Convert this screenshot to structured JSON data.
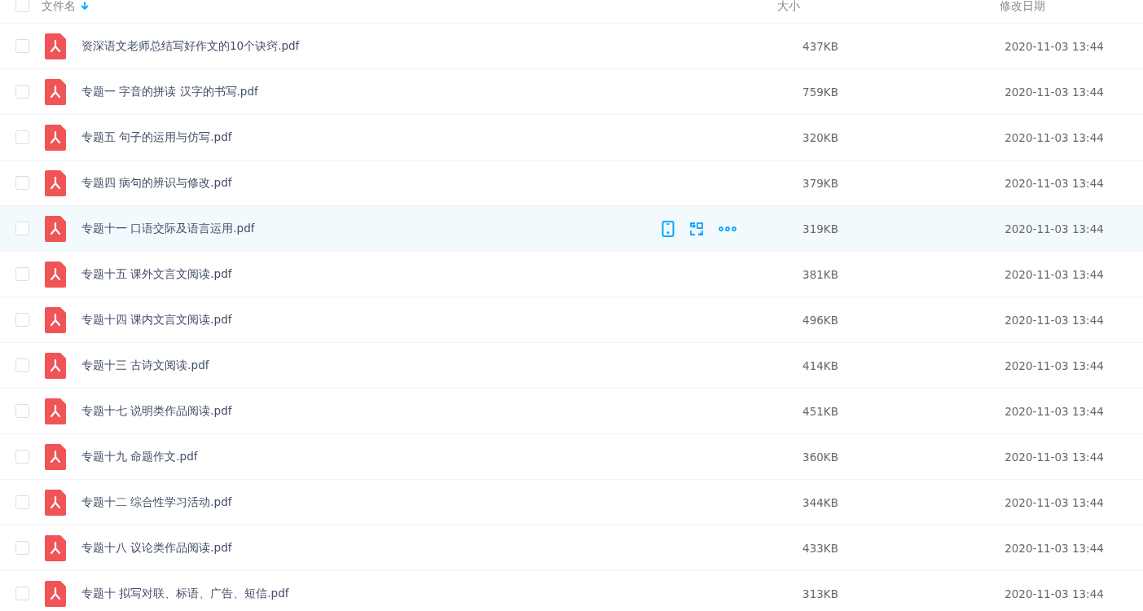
{
  "header": {
    "checked": false,
    "columns": [
      "文件名",
      "大小",
      "修改日期"
    ]
  },
  "rows": [
    {
      "name": "资深语文老师总结写好作文的10个诀窍.pdf",
      "size": "437KB",
      "date": "2020-11-03 13:44",
      "checked": false,
      "hovered": false
    },
    {
      "name": "专题一 字音的拼读 汉字的书写.pdf",
      "size": "759KB",
      "date": "2020-11-03 13:44",
      "checked": false,
      "hovered": false
    },
    {
      "name": "专题五 句子的运用与仿写.pdf",
      "size": "320KB",
      "date": "2020-11-03 13:44",
      "checked": false,
      "hovered": false
    },
    {
      "name": "专题四 病句的辨识与修改.pdf",
      "size": "379KB",
      "date": "2020-11-03 13:44",
      "checked": false,
      "hovered": false
    },
    {
      "name": "专题十一 口语交际及语言运用.pdf",
      "size": "319KB",
      "date": "2020-11-03 13:44",
      "checked": false,
      "hovered": true
    },
    {
      "name": "专题十五 课外文言文阅读.pdf",
      "size": "381KB",
      "date": "2020-11-03 13:44",
      "checked": false,
      "hovered": false
    },
    {
      "name": "专题十四 课内文言文阅读.pdf",
      "size": "496KB",
      "date": "2020-11-03 13:44",
      "checked": false,
      "hovered": false
    },
    {
      "name": "专题十三 古诗文阅读.pdf",
      "size": "414KB",
      "date": "2020-11-03 13:44",
      "checked": false,
      "hovered": false
    },
    {
      "name": "专题十七 说明类作品阅读.pdf",
      "size": "451KB",
      "date": "2020-11-03 13:44",
      "checked": false,
      "hovered": false
    },
    {
      "name": "专题十九 命题作文.pdf",
      "size": "360KB",
      "date": "2020-11-03 13:44",
      "checked": false,
      "hovered": false
    },
    {
      "name": "专题十二 综合性学习活动.pdf",
      "size": "344KB",
      "date": "2020-11-03 13:44",
      "checked": false,
      "hovered": false
    },
    {
      "name": "专题十八 议论类作品阅读.pdf",
      "size": "433KB",
      "date": "2020-11-03 13:44",
      "checked": false,
      "hovered": false
    },
    {
      "name": "专题十 拟写对联、标语、广告、短信.pdf",
      "size": "313KB",
      "date": "2020-11-03 13:44",
      "checked": false,
      "hovered": false
    }
  ]
}
